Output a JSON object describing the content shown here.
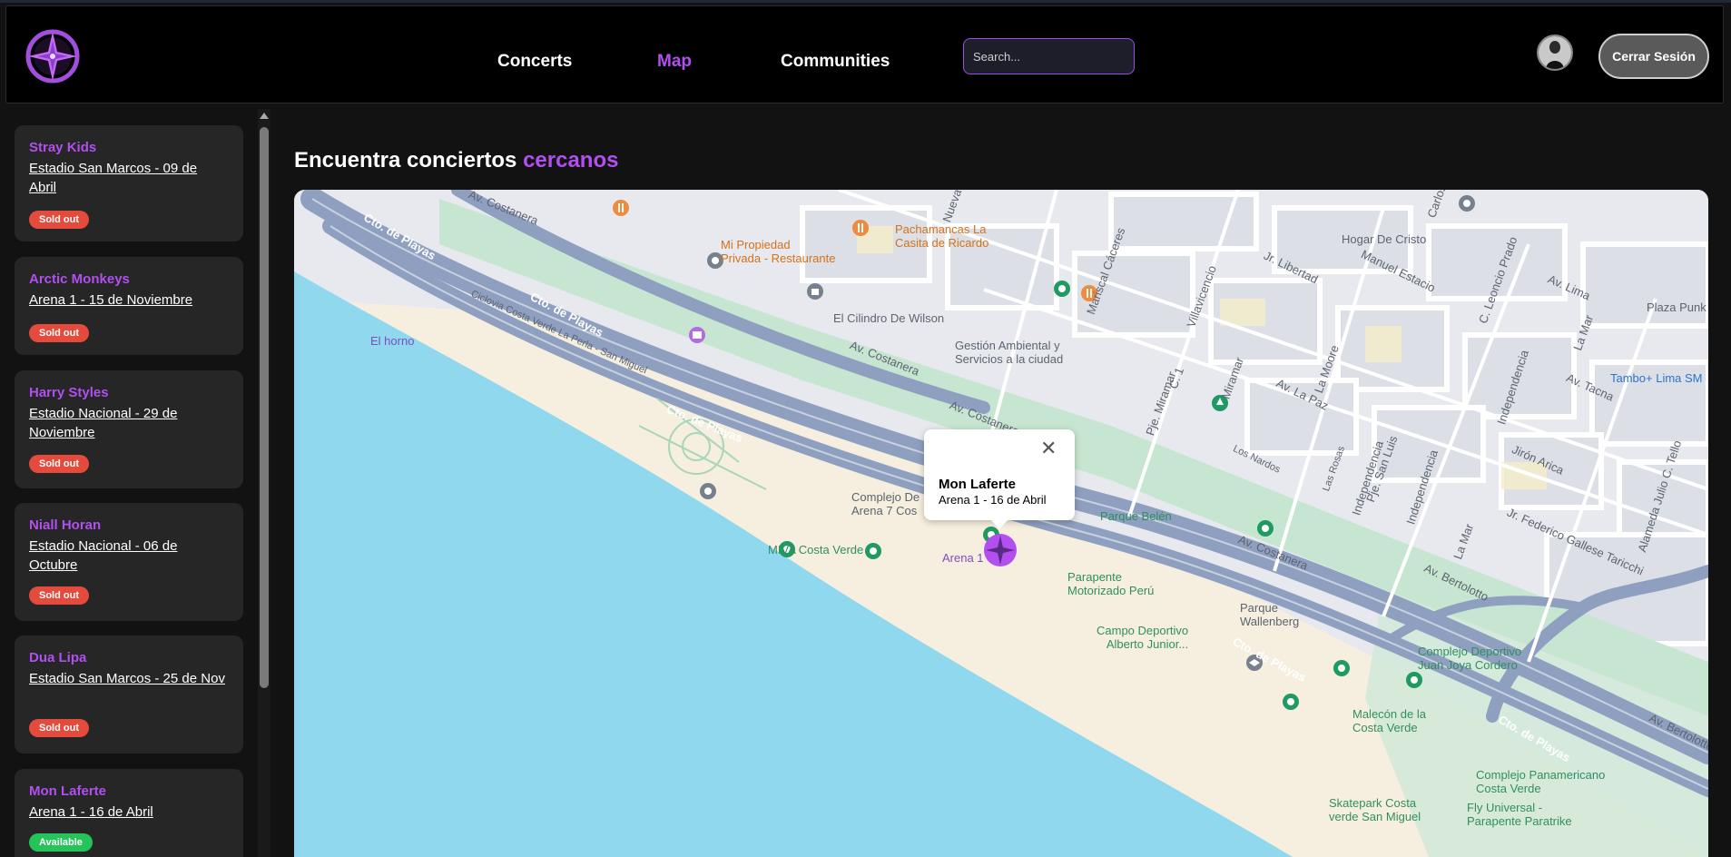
{
  "header": {
    "nav": [
      "Concerts",
      "Map",
      "Communities"
    ],
    "search_placeholder": "Search...",
    "logout_label": "Cerrar Sesión"
  },
  "sidebar": {
    "concerts": [
      {
        "artist": "Stray Kids",
        "venue": "Estadio San Marcos - 09 de Abril",
        "status": "Sold out"
      },
      {
        "artist": "Arctic Monkeys",
        "venue": "Arena 1 - 15 de Noviembre",
        "status": "Sold out"
      },
      {
        "artist": "Harry Styles",
        "venue": "Estadio Nacional - 29 de Noviembre",
        "status": "Sold out"
      },
      {
        "artist": "Niall Horan",
        "venue": "Estadio Nacional - 06 de Octubre",
        "status": "Sold out"
      },
      {
        "artist": "Dua Lipa",
        "venue": "Estadio San Marcos - 25 de Nov",
        "status": "Sold out"
      },
      {
        "artist": "Mon Laferte",
        "venue": "Arena 1 - 16 de Abril",
        "status": "Available"
      }
    ]
  },
  "main": {
    "title_prefix": "Encuentra conciertos",
    "title_accent": "cercanos"
  },
  "map": {
    "popup": {
      "title": "Mon Laferte",
      "subtitle": "Arena 1 - 16 de Abril"
    },
    "labels": {
      "costanera_1": "Av. Costanera",
      "playas_1": "Cto. de Playas",
      "playas_2": "Cto. de Playas",
      "playas_3": "Cto. de Playas",
      "playas_4": "Cto. de Playas",
      "playas_5": "Cto. de Playas",
      "ciclovia": "Ciclovia Costa Verde La Perla - San Miguel",
      "el_horno": "El horno",
      "mi_propiedad": "Mi Propiedad\nPrivada - Restaurante",
      "pachamancas": "Pachamancas La\nCasita de Ricardo",
      "cilindro": "El Cilindro De Wilson",
      "gestion": "Gestión Ambiental y\nServicios a la ciudad",
      "costanera_2": "Av. Costanera",
      "costanera_3": "Av. Costanera",
      "costanera_4": "Av. Costanera",
      "complejo_arena": "Complejo De\nArena 7 Cos",
      "miva": "MIVA Costa Verde",
      "arena1": "Arena 1",
      "parapente": "Parapente\nMotorizado Perú",
      "parque_belen": "Parque Belén",
      "parque_wallenberg": "Parque\nWallenberg",
      "campo_deportivo": "Campo Deportivo\nAlberto Junior...",
      "juan_joya": "Complejo Deportivo\nJuan Joya Cordero",
      "malecon": "Malecón de la\nCosta Verde",
      "skatepark": "Skatepark Costa\nverde San Miguel",
      "panamericano": "Complejo Panamericano\nCosta Verde",
      "fly_universal": "Fly Universal -\nParapente Paratrike",
      "hogar": "Hogar De Cristo",
      "plaza_punk": "Plaza Punk",
      "tambo": "Tambo+ Lima SM",
      "av_lima": "Av. Lima",
      "la_mar": "La Mar",
      "av_tacna": "Av. Tacna",
      "jiron_arica": "Jirón Arica",
      "independencia_1": "Independencia",
      "independencia_2": "Independencia",
      "independencia_3": "Independencia",
      "alameda": "Alameda Julio C. Tello",
      "federico": "Jr. Federico Gallese Taricchi",
      "bertolotto_1": "Av. Bertolotto",
      "bertolotto_2": "Av. Bertolotto",
      "la_mar_2": "La Mar",
      "manuel_estacio": "Manuel Estacio",
      "leoncio": "C. Leoncio Prado",
      "jr_libertad": "Jr. Libertad",
      "villavicencio": "Villavicencio",
      "mariscal": "Mariscal Cáceres",
      "nuevo": "Nueva",
      "miramar": "Miramar",
      "pje_miramar": "Pje. Miramar",
      "c1": "C. 1",
      "av_la_paz": "Av. La Paz",
      "la_moore": "La Moore",
      "los_nardos": "Los Nardos",
      "las_rosas": "Las Rosas",
      "pje_san_luis": "Pje. San Luis",
      "carlos": "Carlos"
    }
  }
}
